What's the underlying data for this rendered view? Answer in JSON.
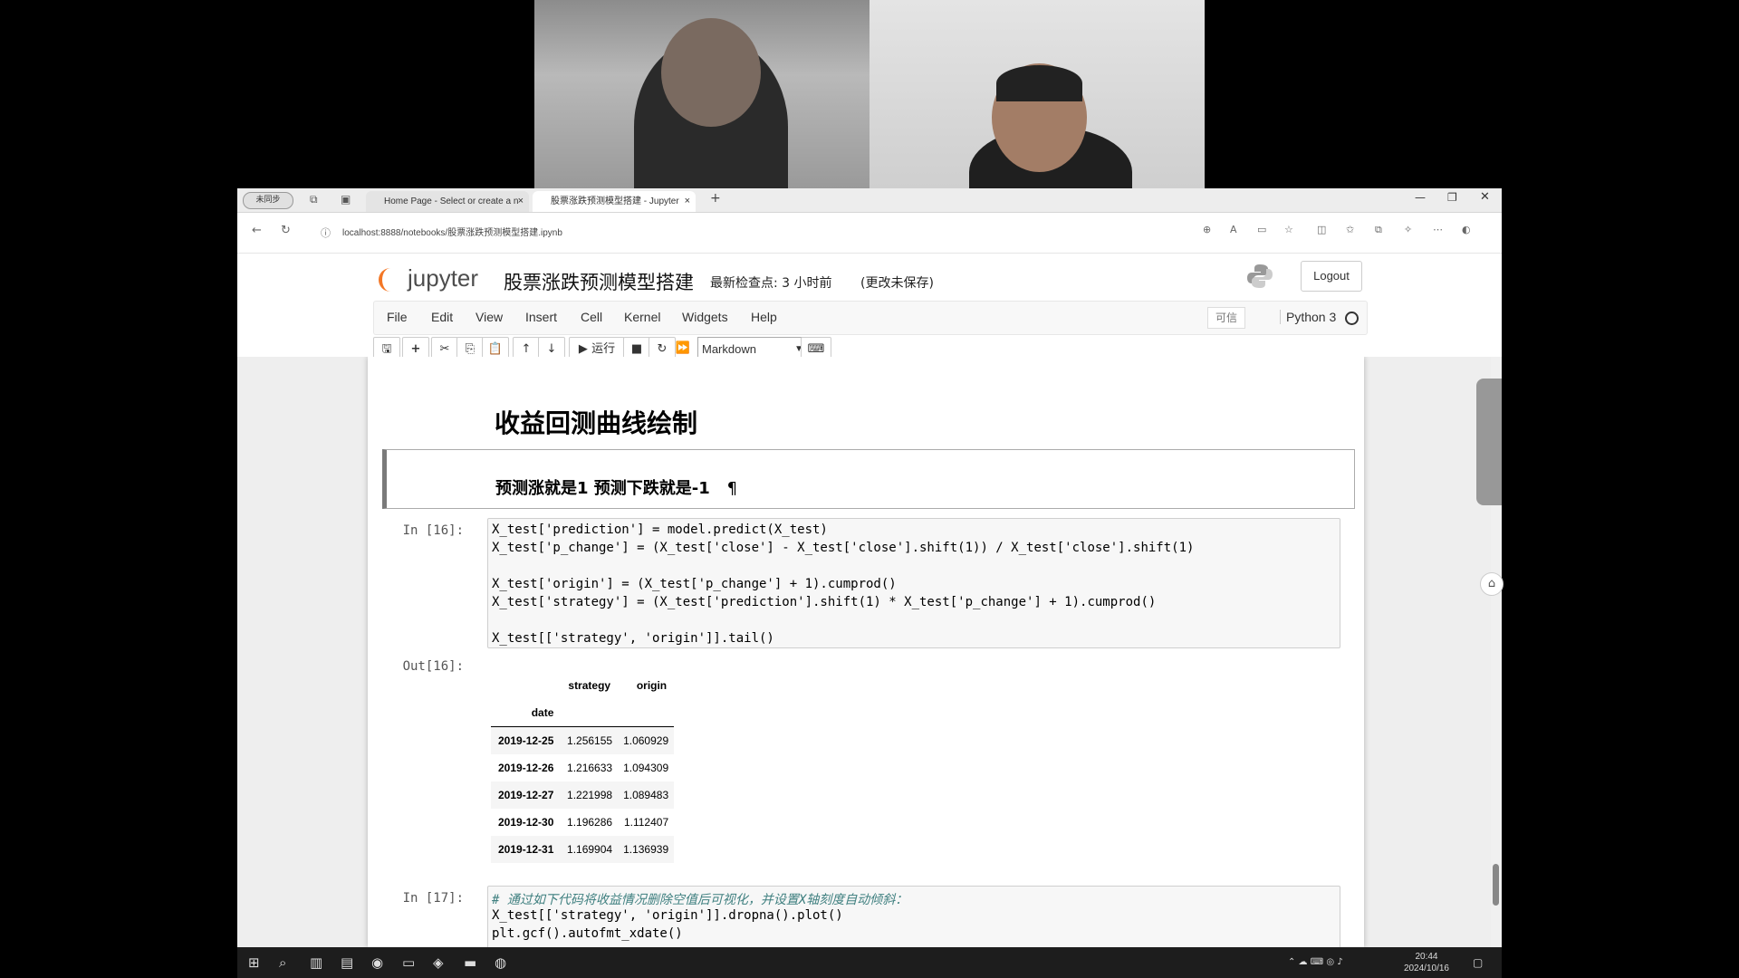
{
  "browser": {
    "sync_label": "未同步",
    "tabs": [
      {
        "label": "Home Page - Select or create a n"
      },
      {
        "label": "股票涨跌预测模型搭建 - Jupyter"
      }
    ],
    "new_tab": "+",
    "url": "localhost:8888/notebooks/股票涨跌预测模型搭建.ipynb"
  },
  "header": {
    "logo": "jupyter",
    "notebook_title": "股票涨跌预测模型搭建",
    "checkpoint": "最新检查点: 3 小时前",
    "unsaved": "(更改未保存)",
    "logout": "Logout"
  },
  "menubar": {
    "items": [
      "File",
      "Edit",
      "View",
      "Insert",
      "Cell",
      "Kernel",
      "Widgets",
      "Help"
    ],
    "trusted": "可信",
    "kernel_name": "Python 3"
  },
  "toolbar": {
    "run_label": "运行",
    "cell_type": "Markdown"
  },
  "notebook": {
    "heading": "收益回测曲线绘制",
    "subheading": "预测涨就是1 预测下跌就是-1",
    "pilcrow": "¶",
    "cell16": {
      "in_prompt": "In  [16]:",
      "lines": [
        "X_test['prediction'] = model.predict(X_test)",
        "X_test['p_change'] = (X_test['close'] - X_test['close'].shift(1)) / X_test['close'].shift(1)",
        "",
        "X_test['origin'] = (X_test['p_change'] + 1).cumprod()",
        "X_test['strategy'] = (X_test['prediction'].shift(1) * X_test['p_change'] + 1).cumprod()",
        "",
        "X_test[['strategy', 'origin']].tail()"
      ],
      "out_prompt": "Out[16]:",
      "table": {
        "columns": [
          "strategy",
          "origin"
        ],
        "index_name": "date",
        "rows": [
          {
            "date": "2019-12-25",
            "strategy": "1.256155",
            "origin": "1.060929"
          },
          {
            "date": "2019-12-26",
            "strategy": "1.216633",
            "origin": "1.094309"
          },
          {
            "date": "2019-12-27",
            "strategy": "1.221998",
            "origin": "1.089483"
          },
          {
            "date": "2019-12-30",
            "strategy": "1.196286",
            "origin": "1.112407"
          },
          {
            "date": "2019-12-31",
            "strategy": "1.169904",
            "origin": "1.136939"
          }
        ]
      }
    },
    "cell17": {
      "in_prompt": "In  [17]:",
      "comment": "# 通过如下代码将收益情况删除空值后可视化，并设置X轴刻度自动倾斜：",
      "lines": [
        "X_test[['strategy', 'origin']].dropna().plot()",
        "plt.gcf().autofmt_xdate()"
      ]
    }
  },
  "taskbar": {
    "time": "20:44",
    "date": "2024/10/16"
  }
}
